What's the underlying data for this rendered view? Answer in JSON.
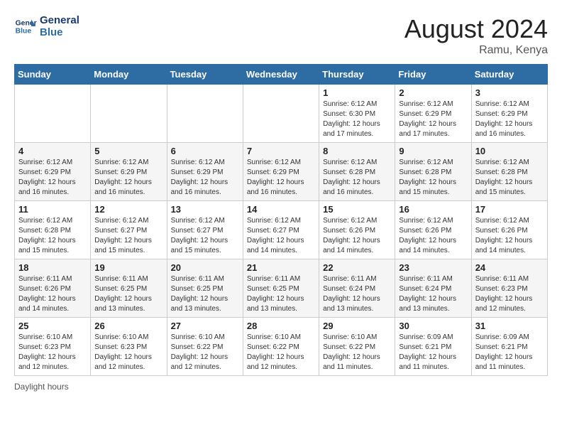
{
  "header": {
    "logo_line1": "General",
    "logo_line2": "Blue",
    "month_year": "August 2024",
    "location": "Ramu, Kenya"
  },
  "days_of_week": [
    "Sunday",
    "Monday",
    "Tuesday",
    "Wednesday",
    "Thursday",
    "Friday",
    "Saturday"
  ],
  "weeks": [
    [
      {
        "day": "",
        "info": ""
      },
      {
        "day": "",
        "info": ""
      },
      {
        "day": "",
        "info": ""
      },
      {
        "day": "",
        "info": ""
      },
      {
        "day": "1",
        "info": "Sunrise: 6:12 AM\nSunset: 6:30 PM\nDaylight: 12 hours and 17 minutes."
      },
      {
        "day": "2",
        "info": "Sunrise: 6:12 AM\nSunset: 6:29 PM\nDaylight: 12 hours and 17 minutes."
      },
      {
        "day": "3",
        "info": "Sunrise: 6:12 AM\nSunset: 6:29 PM\nDaylight: 12 hours and 16 minutes."
      }
    ],
    [
      {
        "day": "4",
        "info": "Sunrise: 6:12 AM\nSunset: 6:29 PM\nDaylight: 12 hours and 16 minutes."
      },
      {
        "day": "5",
        "info": "Sunrise: 6:12 AM\nSunset: 6:29 PM\nDaylight: 12 hours and 16 minutes."
      },
      {
        "day": "6",
        "info": "Sunrise: 6:12 AM\nSunset: 6:29 PM\nDaylight: 12 hours and 16 minutes."
      },
      {
        "day": "7",
        "info": "Sunrise: 6:12 AM\nSunset: 6:29 PM\nDaylight: 12 hours and 16 minutes."
      },
      {
        "day": "8",
        "info": "Sunrise: 6:12 AM\nSunset: 6:28 PM\nDaylight: 12 hours and 16 minutes."
      },
      {
        "day": "9",
        "info": "Sunrise: 6:12 AM\nSunset: 6:28 PM\nDaylight: 12 hours and 15 minutes."
      },
      {
        "day": "10",
        "info": "Sunrise: 6:12 AM\nSunset: 6:28 PM\nDaylight: 12 hours and 15 minutes."
      }
    ],
    [
      {
        "day": "11",
        "info": "Sunrise: 6:12 AM\nSunset: 6:28 PM\nDaylight: 12 hours and 15 minutes."
      },
      {
        "day": "12",
        "info": "Sunrise: 6:12 AM\nSunset: 6:27 PM\nDaylight: 12 hours and 15 minutes."
      },
      {
        "day": "13",
        "info": "Sunrise: 6:12 AM\nSunset: 6:27 PM\nDaylight: 12 hours and 15 minutes."
      },
      {
        "day": "14",
        "info": "Sunrise: 6:12 AM\nSunset: 6:27 PM\nDaylight: 12 hours and 14 minutes."
      },
      {
        "day": "15",
        "info": "Sunrise: 6:12 AM\nSunset: 6:26 PM\nDaylight: 12 hours and 14 minutes."
      },
      {
        "day": "16",
        "info": "Sunrise: 6:12 AM\nSunset: 6:26 PM\nDaylight: 12 hours and 14 minutes."
      },
      {
        "day": "17",
        "info": "Sunrise: 6:12 AM\nSunset: 6:26 PM\nDaylight: 12 hours and 14 minutes."
      }
    ],
    [
      {
        "day": "18",
        "info": "Sunrise: 6:11 AM\nSunset: 6:26 PM\nDaylight: 12 hours and 14 minutes."
      },
      {
        "day": "19",
        "info": "Sunrise: 6:11 AM\nSunset: 6:25 PM\nDaylight: 12 hours and 13 minutes."
      },
      {
        "day": "20",
        "info": "Sunrise: 6:11 AM\nSunset: 6:25 PM\nDaylight: 12 hours and 13 minutes."
      },
      {
        "day": "21",
        "info": "Sunrise: 6:11 AM\nSunset: 6:25 PM\nDaylight: 12 hours and 13 minutes."
      },
      {
        "day": "22",
        "info": "Sunrise: 6:11 AM\nSunset: 6:24 PM\nDaylight: 12 hours and 13 minutes."
      },
      {
        "day": "23",
        "info": "Sunrise: 6:11 AM\nSunset: 6:24 PM\nDaylight: 12 hours and 13 minutes."
      },
      {
        "day": "24",
        "info": "Sunrise: 6:11 AM\nSunset: 6:23 PM\nDaylight: 12 hours and 12 minutes."
      }
    ],
    [
      {
        "day": "25",
        "info": "Sunrise: 6:10 AM\nSunset: 6:23 PM\nDaylight: 12 hours and 12 minutes."
      },
      {
        "day": "26",
        "info": "Sunrise: 6:10 AM\nSunset: 6:23 PM\nDaylight: 12 hours and 12 minutes."
      },
      {
        "day": "27",
        "info": "Sunrise: 6:10 AM\nSunset: 6:22 PM\nDaylight: 12 hours and 12 minutes."
      },
      {
        "day": "28",
        "info": "Sunrise: 6:10 AM\nSunset: 6:22 PM\nDaylight: 12 hours and 12 minutes."
      },
      {
        "day": "29",
        "info": "Sunrise: 6:10 AM\nSunset: 6:22 PM\nDaylight: 12 hours and 11 minutes."
      },
      {
        "day": "30",
        "info": "Sunrise: 6:09 AM\nSunset: 6:21 PM\nDaylight: 12 hours and 11 minutes."
      },
      {
        "day": "31",
        "info": "Sunrise: 6:09 AM\nSunset: 6:21 PM\nDaylight: 12 hours and 11 minutes."
      }
    ]
  ],
  "footer": {
    "daylight_label": "Daylight hours"
  }
}
